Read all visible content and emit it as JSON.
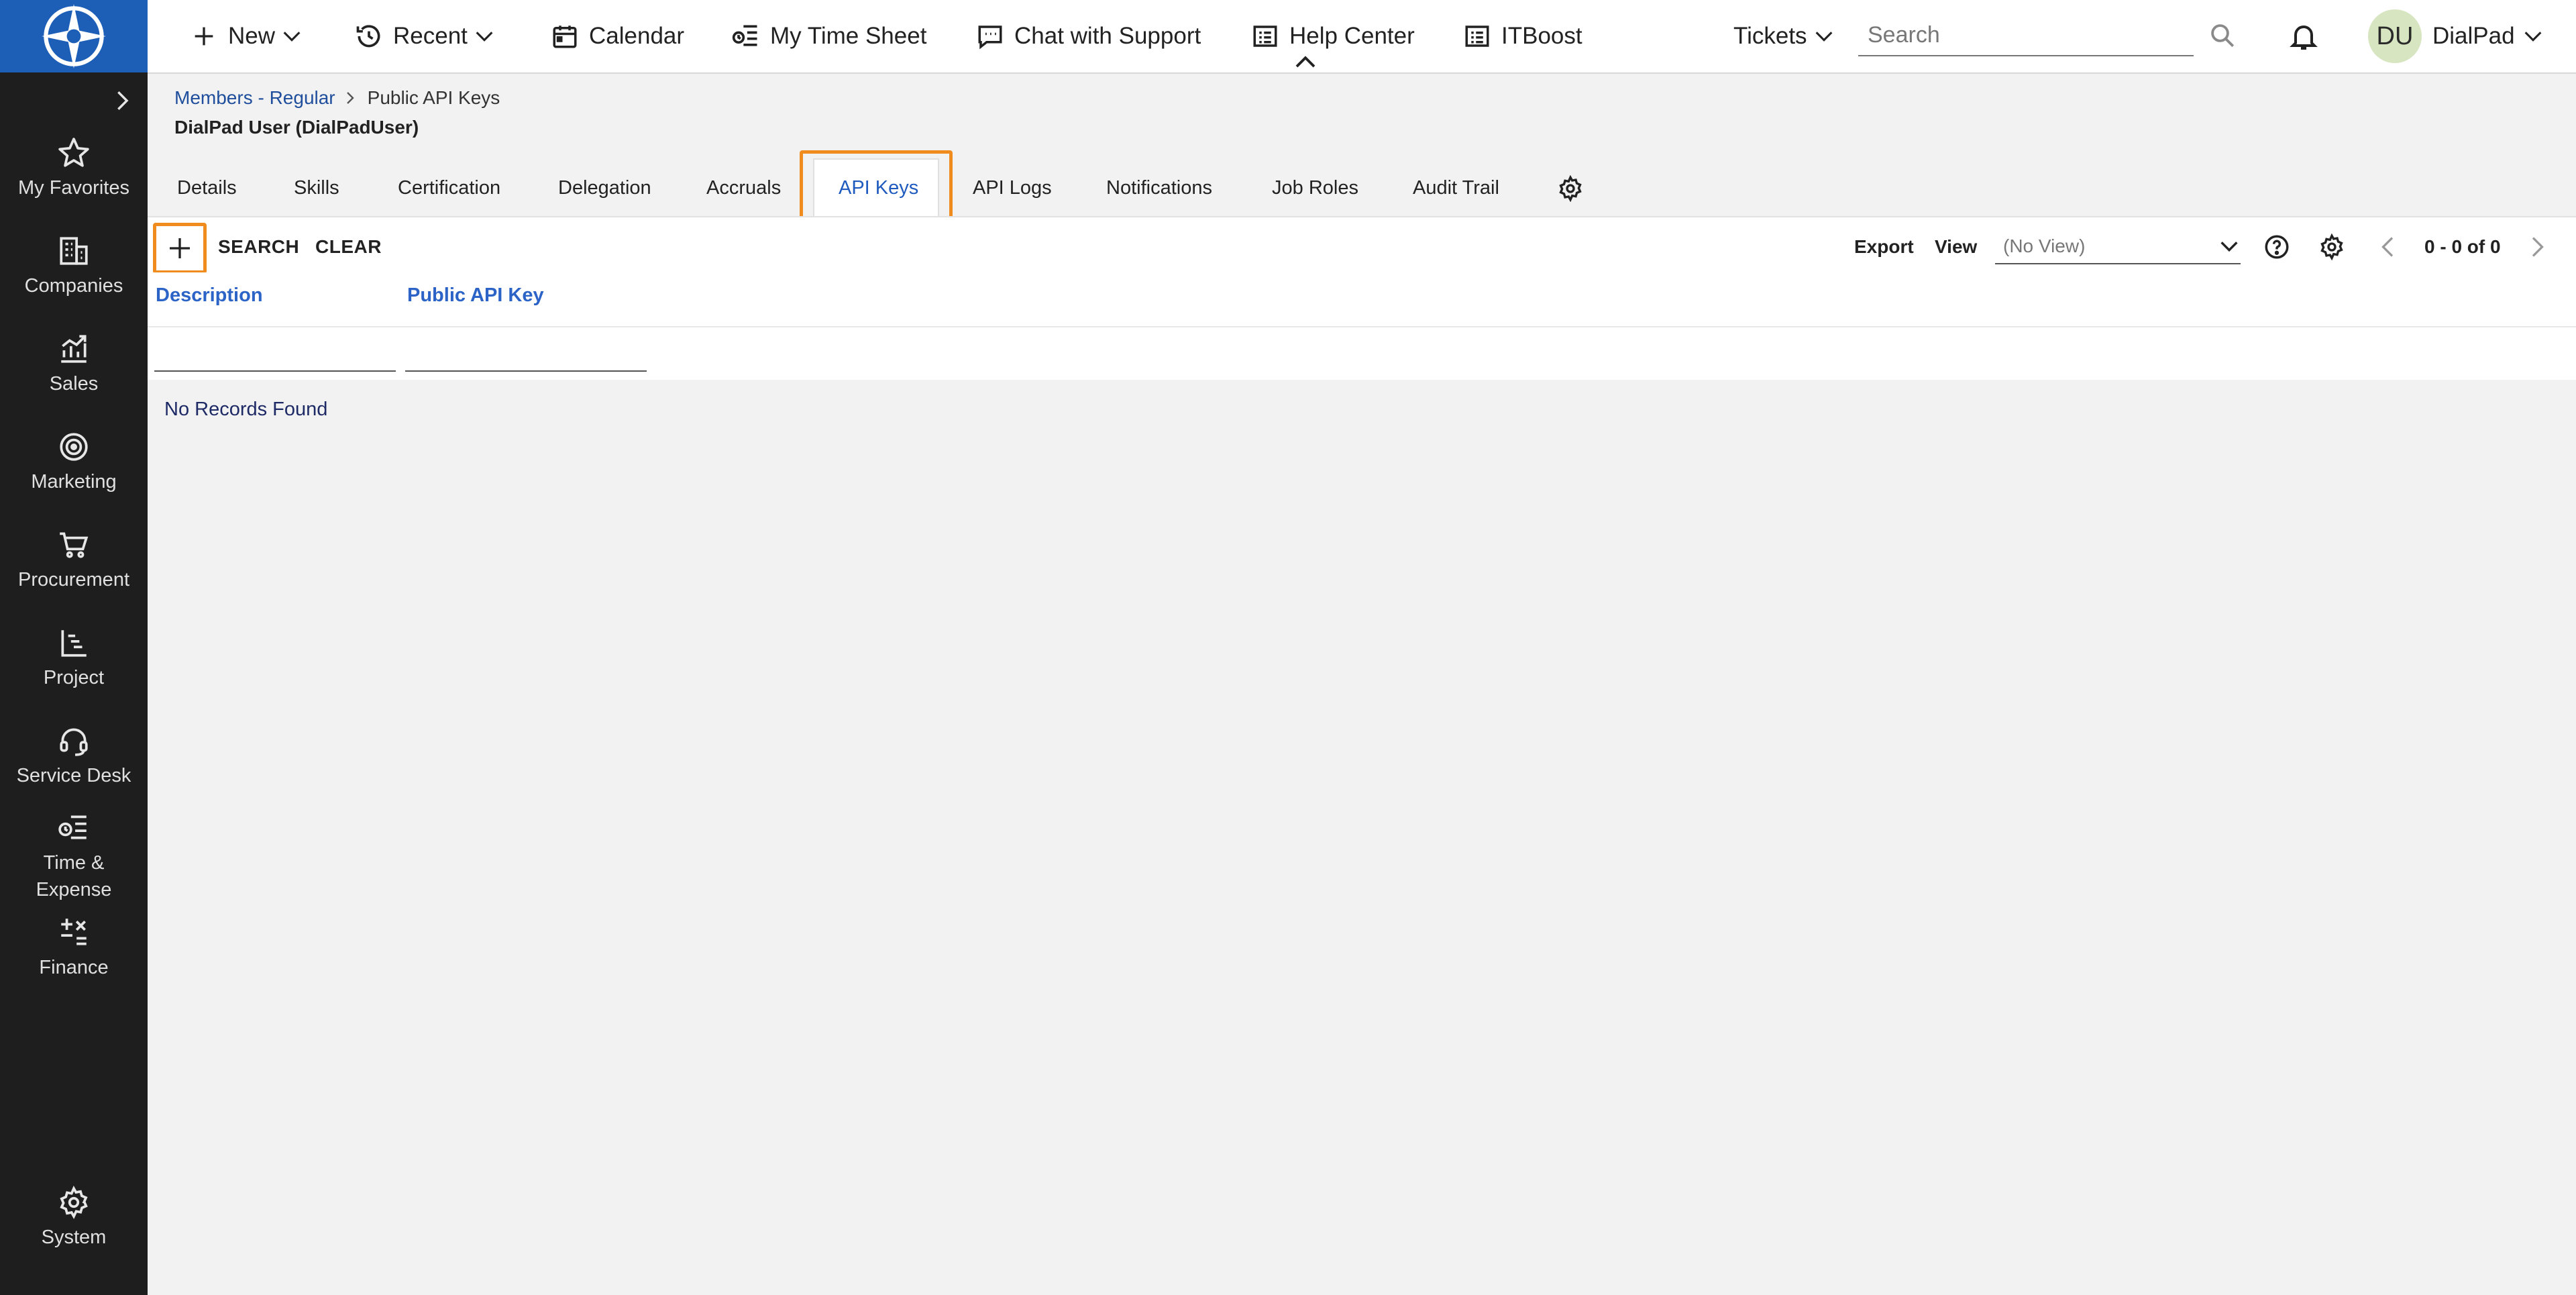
{
  "colors": {
    "sidebar_bg": "#1e1e1e",
    "logo_bg": "#1d5fb7",
    "accent_orange": "#f08c1e",
    "link_blue": "#1f4e9c",
    "active_tab_blue": "#1f5bbf",
    "avatar_bg": "#d7e5c0"
  },
  "topbar": {
    "new_label": "New",
    "recent_label": "Recent",
    "calendar_label": "Calendar",
    "timesheet_label": "My Time Sheet",
    "chat_label": "Chat with Support",
    "help_label": "Help Center",
    "itboost_label": "ITBoost",
    "tickets_label": "Tickets",
    "search_placeholder": "Search",
    "avatar_initials": "DU",
    "user_label": "DialPad"
  },
  "sidebar": {
    "items": [
      {
        "label": "My Favorites",
        "icon": "star-icon"
      },
      {
        "label": "Companies",
        "icon": "building-icon"
      },
      {
        "label": "Sales",
        "icon": "chart-icon"
      },
      {
        "label": "Marketing",
        "icon": "target-icon"
      },
      {
        "label": "Procurement",
        "icon": "cart-icon"
      },
      {
        "label": "Project",
        "icon": "gantt-icon"
      },
      {
        "label": "Service Desk",
        "icon": "headset-icon"
      },
      {
        "label": "Time & Expense",
        "icon": "timesheet-icon"
      },
      {
        "label": "Finance",
        "icon": "calculator-icon"
      },
      {
        "label": "System",
        "icon": "gear-icon"
      }
    ]
  },
  "breadcrumb": {
    "parent": "Members - Regular",
    "current": "Public API Keys"
  },
  "page_title": "DialPad User (DialPadUser)",
  "tabs": [
    {
      "label": "Details"
    },
    {
      "label": "Skills"
    },
    {
      "label": "Certification"
    },
    {
      "label": "Delegation"
    },
    {
      "label": "Accruals"
    },
    {
      "label": "API Keys",
      "active": true
    },
    {
      "label": "API Logs"
    },
    {
      "label": "Notifications"
    },
    {
      "label": "Job Roles"
    },
    {
      "label": "Audit Trail"
    }
  ],
  "toolbar": {
    "search_label": "SEARCH",
    "clear_label": "CLEAR",
    "export_label": "Export",
    "view_label": "View",
    "view_value": "(No View)",
    "pager_text": "0 - 0 of 0"
  },
  "grid": {
    "columns": [
      "Description",
      "Public API Key"
    ],
    "empty_message": "No Records Found"
  }
}
